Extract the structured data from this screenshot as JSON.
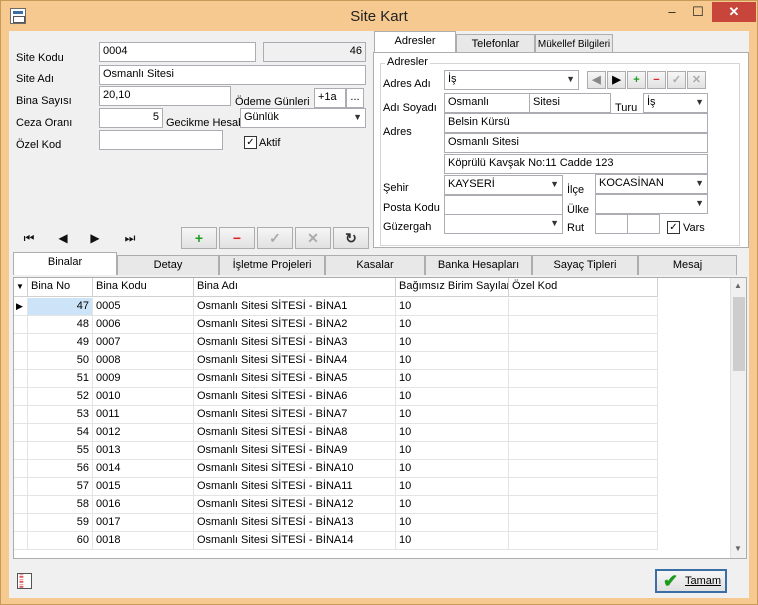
{
  "window": {
    "title": "Site Kart",
    "min": "–",
    "max": "☐",
    "close": "✕"
  },
  "left": {
    "site_kodu_label": "Site Kodu",
    "site_kodu": "0004",
    "site_no": "46",
    "site_adi_label": "Site Adı",
    "site_adi": "Osmanlı Sitesi",
    "bina_sayisi_label": "Bina Sayısı",
    "bina_sayisi": "20,10",
    "odeme_gunleri_label": "Ödeme Günleri",
    "odeme_gunleri": "+1a",
    "odeme_btn": "...",
    "ceza_orani_label": "Ceza Oranı",
    "ceza_orani": "5",
    "gecikme_label": "Gecikme Hesabı",
    "gecikme": "Günlük",
    "ozel_kod_label": "Özel Kod",
    "ozel_kod": "",
    "aktif_label": "Aktif",
    "aktif_check": "✓"
  },
  "nav": {
    "first": "⏮",
    "prev": "◀",
    "next": "▶",
    "last": "⏭"
  },
  "actions": {
    "add": "+",
    "delete": "−",
    "save": "✓",
    "cancel": "✕",
    "refresh": "↻"
  },
  "right_tabs": [
    "Adresler",
    "Telefonlar",
    "Mükellef Bilgileri"
  ],
  "address": {
    "group_title": "Adresler",
    "adres_adi_label": "Adres Adı",
    "adres_adi": "İş",
    "btn_prev": "◀",
    "btn_next": "▶",
    "btn_add": "+",
    "btn_del": "−",
    "btn_ok": "✓",
    "btn_cancel": "✕",
    "adi_soyadi_label": "Adı Soyadı",
    "adi": "Osmanlı",
    "soyadi": "Sitesi",
    "turu_label": "Turu",
    "turu": "İş",
    "adres_label": "Adres",
    "adres1": "Belsin Kürsü",
    "adres2": "Osmanlı Sitesi",
    "adres3": "Köprülü Kavşak No:11 Cadde 123",
    "sehir_label": "Şehir",
    "sehir": "KAYSERİ",
    "ilce_label": "İlçe",
    "ilce": "KOCASİNAN",
    "posta_kodu_label": "Posta Kodu",
    "posta_kodu": "",
    "ulke_label": "Ülke",
    "ulke": "",
    "guzergah_label": "Güzergah",
    "guzergah": "",
    "rut_label": "Rut",
    "rut1": "",
    "rut2": "",
    "vars_label": "Vars",
    "vars_check": "✓"
  },
  "bottom_tabs": [
    "Binalar",
    "Detay",
    "İşletme Projeleri",
    "Kasalar",
    "Banka Hesapları",
    "Sayaç Tipleri",
    "Mesaj"
  ],
  "grid": {
    "headers": [
      "Bina No",
      "Bina Kodu",
      "Bina Adı",
      "Bağımsız Birim Sayıları",
      "Özel Kod"
    ],
    "rows": [
      [
        "47",
        "0005",
        "Osmanlı Sitesi SİTESİ - BİNA1",
        "10",
        ""
      ],
      [
        "48",
        "0006",
        "Osmanlı Sitesi SİTESİ - BİNA2",
        "10",
        ""
      ],
      [
        "49",
        "0007",
        "Osmanlı Sitesi SİTESİ - BİNA3",
        "10",
        ""
      ],
      [
        "50",
        "0008",
        "Osmanlı Sitesi SİTESİ - BİNA4",
        "10",
        ""
      ],
      [
        "51",
        "0009",
        "Osmanlı Sitesi SİTESİ - BİNA5",
        "10",
        ""
      ],
      [
        "52",
        "0010",
        "Osmanlı Sitesi SİTESİ - BİNA6",
        "10",
        ""
      ],
      [
        "53",
        "0011",
        "Osmanlı Sitesi SİTESİ - BİNA7",
        "10",
        ""
      ],
      [
        "54",
        "0012",
        "Osmanlı Sitesi SİTESİ - BİNA8",
        "10",
        ""
      ],
      [
        "55",
        "0013",
        "Osmanlı Sitesi SİTESİ - BİNA9",
        "10",
        ""
      ],
      [
        "56",
        "0014",
        "Osmanlı Sitesi SİTESİ - BİNA10",
        "10",
        ""
      ],
      [
        "57",
        "0015",
        "Osmanlı Sitesi SİTESİ - BİNA11",
        "10",
        ""
      ],
      [
        "58",
        "0016",
        "Osmanlı Sitesi SİTESİ - BİNA12",
        "10",
        ""
      ],
      [
        "59",
        "0017",
        "Osmanlı Sitesi SİTESİ - BİNA13",
        "10",
        ""
      ],
      [
        "60",
        "0018",
        "Osmanlı Sitesi SİTESİ - BİNA14",
        "10",
        ""
      ]
    ]
  },
  "footer": {
    "ok_label": "Tamam",
    "ok_icon": "✔"
  }
}
